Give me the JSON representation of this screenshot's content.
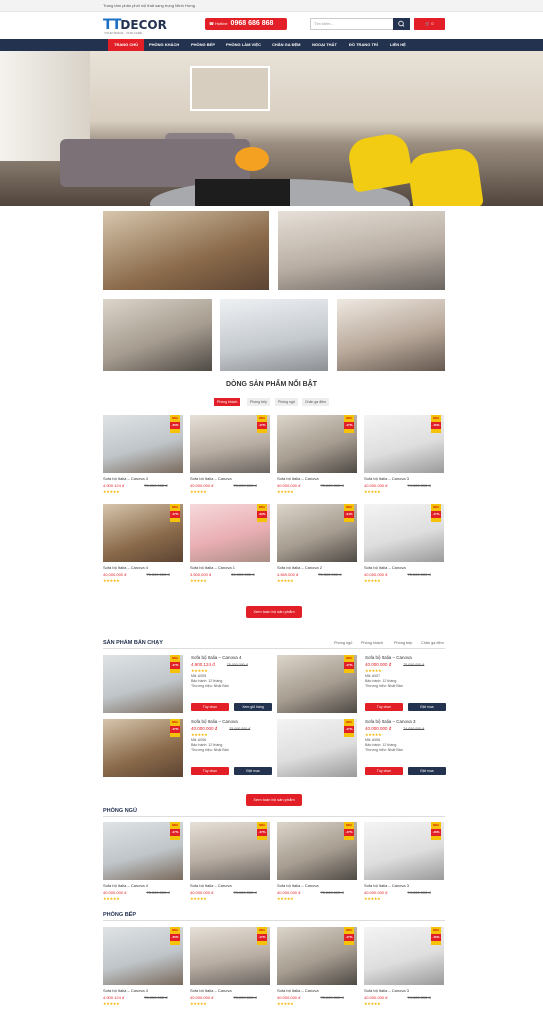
{
  "topbar": {
    "text": "Trang tâm phân phối nội thất sang trọng Minh Hưng"
  },
  "header": {
    "logo_tt": "TT",
    "logo_decor": "DECOR",
    "logo_tag": "YOUR SPACE · OUR CARE",
    "hotline_label": "Hotline",
    "hotline_number": "0968 686 868",
    "search_placeholder": "Tìm kiếm...",
    "cart_label": "0"
  },
  "nav": [
    "TRANG CHỦ",
    "PHÒNG KHÁCH",
    "PHÒNG BẾP",
    "PHÒNG LÀM VIỆC",
    "CHĂN GA ĐỆM",
    "NGOẠI THẤT",
    "ĐỒ TRANG TRÍ",
    "LIÊN HỆ"
  ],
  "featured": {
    "title": "DÒNG SẢN PHẨM NỔI BẬT",
    "tabs": [
      "Phòng khách",
      "Phòng bếp",
      "Phòng ngủ",
      "Chăn ga đệm"
    ],
    "products": [
      {
        "name": "Sofa bộ Italia – Canova 4",
        "price": "4.900.124 đ",
        "old": "75.000.000 đ",
        "badge": "-35%"
      },
      {
        "name": "Sofa bộ Italia – Canova",
        "price": "40.000.000 đ",
        "old": "75.000.000 đ",
        "badge": "-47%"
      },
      {
        "name": "Sofa bộ Italia – Canova",
        "price": "40.000.000 đ",
        "old": "75.000.000 đ",
        "badge": "-47%"
      },
      {
        "name": "Sofa bộ Italia – Canova 3",
        "price": "40.000.000 đ",
        "old": "74.000.000 đ",
        "badge": "-46%"
      },
      {
        "name": "Sofa bộ Italia – Canova 4",
        "price": "40.000.000 đ",
        "old": "75.000.000 đ",
        "badge": "-47%"
      },
      {
        "name": "Sofa bộ Italia – Canova 1",
        "price": "3.500.000 đ",
        "old": "35.000.000 đ",
        "badge": "-90%"
      },
      {
        "name": "Sofa bộ Italia – Canova 2",
        "price": "4.569.000 đ",
        "old": "75.000.000 đ",
        "badge": "-94%"
      },
      {
        "name": "Sofa bộ Italia – Canova",
        "price": "40.000.000 đ",
        "old": "75.000.000 đ",
        "badge": "-47%"
      }
    ],
    "button": "Xem toàn bộ sản phẩm"
  },
  "bestseller": {
    "title": "SẢN PHẨM BÁN CHẠY",
    "tabs": [
      "Phòng ngủ",
      "Phòng khách",
      "Phòng bếp",
      "Chăn ga đệm"
    ],
    "items": [
      {
        "name": "Sofa bộ Italia – Canova 4",
        "price": "4.900.124 đ",
        "old": "75.000.000 đ",
        "ma": "Mã: A005",
        "bh": "Bảo hành: 12 tháng",
        "th": "Thương hiệu: Nhật Bản",
        "b1": "Tùy chọn",
        "b2": "Xem giỏ hàng"
      },
      {
        "name": "Sofa bộ Italia – Canova",
        "price": "40.000.000 đ",
        "old": "75.000.000 đ",
        "ma": "Mã: A007",
        "bh": "Bảo hành: 12 tháng",
        "th": "Thương hiệu: Nhật Bản",
        "b1": "Tùy chọn",
        "b2": "Đặt mua"
      },
      {
        "name": "Sofa bộ Italia – Canova",
        "price": "40.000.000 đ",
        "old": "75.000.000 đ",
        "ma": "Mã: A006",
        "bh": "Bảo hành: 12 tháng",
        "th": "Thương hiệu: Nhật Bản",
        "b1": "Tùy chọn",
        "b2": "Đặt mua"
      },
      {
        "name": "Sofa bộ Italia – Canova 3",
        "price": "40.000.000 đ",
        "old": "74.000.000 đ",
        "ma": "Mã: A006",
        "bh": "Bảo hành: 12 tháng",
        "th": "Thương hiệu: Nhật Bản",
        "b1": "Tùy chọn",
        "b2": "Đặt mua"
      }
    ],
    "button": "Xem toàn bộ sản phẩm"
  },
  "phongngu": {
    "title": "PHÒNG NGỦ",
    "products": [
      {
        "name": "Sofa bộ Italia – Canova 4",
        "price": "40.000.000 đ",
        "old": "75.000.000 đ",
        "badge": "-47%"
      },
      {
        "name": "Sofa bộ Italia – Canova",
        "price": "40.000.000 đ",
        "old": "75.000.000 đ",
        "badge": "-47%"
      },
      {
        "name": "Sofa bộ Italia – Canova",
        "price": "40.000.000 đ",
        "old": "75.000.000 đ",
        "badge": "-47%"
      },
      {
        "name": "Sofa bộ Italia – Canova 3",
        "price": "40.000.000 đ",
        "old": "74.000.000 đ",
        "badge": "-46%"
      }
    ]
  },
  "phongbep": {
    "title": "PHÒNG BẾP",
    "products": [
      {
        "name": "Sofa bộ Italia – Canova 4",
        "price": "4.900.124 đ",
        "old": "75.000.000 đ",
        "badge": "-35%"
      },
      {
        "name": "Sofa bộ Italia – Canova",
        "price": "40.000.000 đ",
        "old": "75.000.000 đ",
        "badge": "-47%"
      },
      {
        "name": "Sofa bộ Italia – Canova",
        "price": "40.000.000 đ",
        "old": "75.000.000 đ",
        "badge": "-47%"
      },
      {
        "name": "Sofa bộ Italia – Canova 3",
        "price": "40.000.000 đ",
        "old": "74.000.000 đ",
        "badge": "-46%"
      }
    ]
  },
  "badge_top": "Mới",
  "stars": "★★★★★"
}
